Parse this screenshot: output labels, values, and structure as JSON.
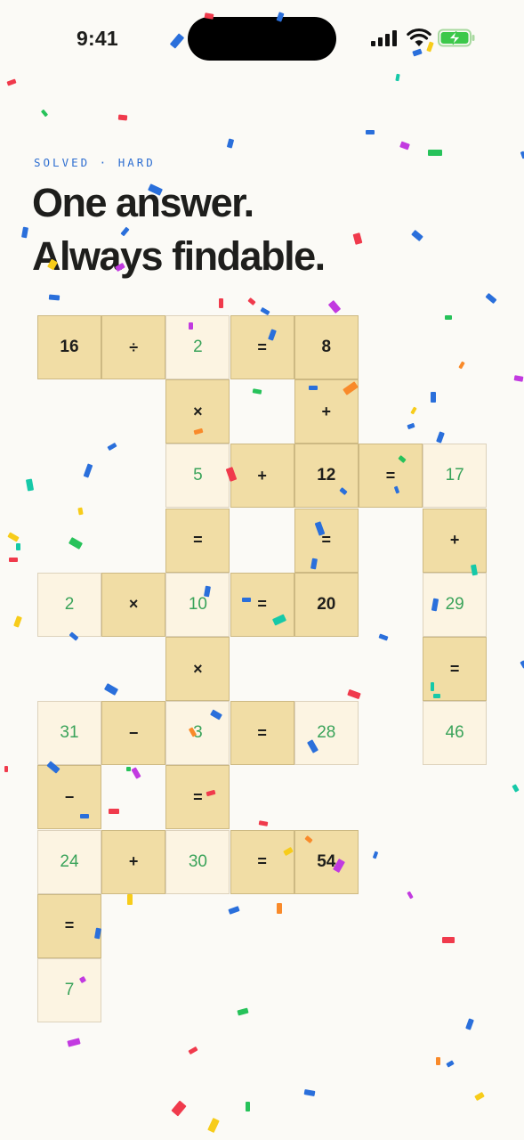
{
  "status_bar": {
    "time": "9:41"
  },
  "header": {
    "eyebrow": "SOLVED · HARD",
    "line1": "One answer.",
    "line2": "Always findable."
  },
  "colors": {
    "tile": "#f1dda5",
    "answer_tile": "#fcf4e2",
    "answer_text": "#3aa35a",
    "eyebrow": "#2f6fd1",
    "background": "#fbfaf6"
  },
  "puzzle": {
    "cells": [
      {
        "row": 0,
        "col": 0,
        "text": "16",
        "kind": "given"
      },
      {
        "row": 0,
        "col": 1,
        "text": "÷",
        "kind": "op"
      },
      {
        "row": 0,
        "col": 2,
        "text": "2",
        "kind": "answer"
      },
      {
        "row": 0,
        "col": 3,
        "text": "=",
        "kind": "op"
      },
      {
        "row": 0,
        "col": 4,
        "text": "8",
        "kind": "given"
      },
      {
        "row": 1,
        "col": 2,
        "text": "×",
        "kind": "op"
      },
      {
        "row": 1,
        "col": 4,
        "text": "+",
        "kind": "op"
      },
      {
        "row": 2,
        "col": 2,
        "text": "5",
        "kind": "answer"
      },
      {
        "row": 2,
        "col": 3,
        "text": "+",
        "kind": "op"
      },
      {
        "row": 2,
        "col": 4,
        "text": "12",
        "kind": "given"
      },
      {
        "row": 2,
        "col": 5,
        "text": "=",
        "kind": "op"
      },
      {
        "row": 2,
        "col": 6,
        "text": "17",
        "kind": "answer"
      },
      {
        "row": 3,
        "col": 2,
        "text": "=",
        "kind": "op"
      },
      {
        "row": 3,
        "col": 4,
        "text": "=",
        "kind": "op"
      },
      {
        "row": 3,
        "col": 6,
        "text": "+",
        "kind": "op"
      },
      {
        "row": 4,
        "col": 0,
        "text": "2",
        "kind": "answer"
      },
      {
        "row": 4,
        "col": 1,
        "text": "×",
        "kind": "op"
      },
      {
        "row": 4,
        "col": 2,
        "text": "10",
        "kind": "answer"
      },
      {
        "row": 4,
        "col": 3,
        "text": "=",
        "kind": "op"
      },
      {
        "row": 4,
        "col": 4,
        "text": "20",
        "kind": "given"
      },
      {
        "row": 4,
        "col": 6,
        "text": "29",
        "kind": "answer"
      },
      {
        "row": 5,
        "col": 2,
        "text": "×",
        "kind": "op"
      },
      {
        "row": 5,
        "col": 6,
        "text": "=",
        "kind": "op"
      },
      {
        "row": 6,
        "col": 0,
        "text": "31",
        "kind": "answer"
      },
      {
        "row": 6,
        "col": 1,
        "text": "−",
        "kind": "op"
      },
      {
        "row": 6,
        "col": 2,
        "text": "3",
        "kind": "answer"
      },
      {
        "row": 6,
        "col": 3,
        "text": "=",
        "kind": "op"
      },
      {
        "row": 6,
        "col": 4,
        "text": "28",
        "kind": "answer"
      },
      {
        "row": 6,
        "col": 6,
        "text": "46",
        "kind": "answer"
      },
      {
        "row": 7,
        "col": 0,
        "text": "−",
        "kind": "op"
      },
      {
        "row": 7,
        "col": 2,
        "text": "=",
        "kind": "op"
      },
      {
        "row": 8,
        "col": 0,
        "text": "24",
        "kind": "answer"
      },
      {
        "row": 8,
        "col": 1,
        "text": "+",
        "kind": "op"
      },
      {
        "row": 8,
        "col": 2,
        "text": "30",
        "kind": "answer"
      },
      {
        "row": 8,
        "col": 3,
        "text": "=",
        "kind": "op"
      },
      {
        "row": 8,
        "col": 4,
        "text": "54",
        "kind": "given"
      },
      {
        "row": 9,
        "col": 0,
        "text": "=",
        "kind": "op"
      },
      {
        "row": 10,
        "col": 0,
        "text": "7",
        "kind": "answer"
      }
    ]
  }
}
